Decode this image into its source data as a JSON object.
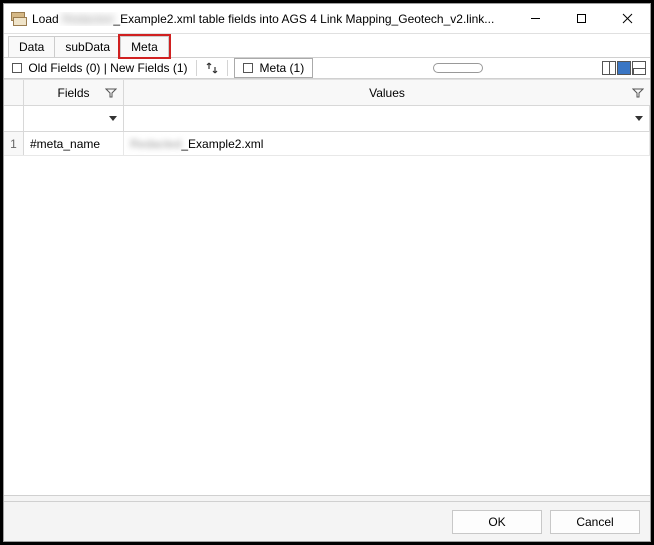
{
  "window": {
    "title_prefix": "Load ",
    "title_redacted": "Redacted",
    "title_suffix": "_Example2.xml table fields into AGS 4 Link Mapping_Geotech_v2.link..."
  },
  "tabs": {
    "items": [
      {
        "label": "Data"
      },
      {
        "label": "subData"
      },
      {
        "label": "Meta"
      }
    ]
  },
  "toolbar": {
    "old_fields": "Old Fields (0)",
    "sep": " | ",
    "new_fields": "New Fields (1)",
    "meta_tab": "Meta (1)"
  },
  "grid": {
    "headers": {
      "fields": "Fields",
      "values": "Values"
    },
    "rows": [
      {
        "num": "1",
        "field": "#meta_name",
        "value_redacted": "Redacted",
        "value_suffix": "_Example2.xml"
      }
    ]
  },
  "footer": {
    "ok": "OK",
    "cancel": "Cancel"
  }
}
